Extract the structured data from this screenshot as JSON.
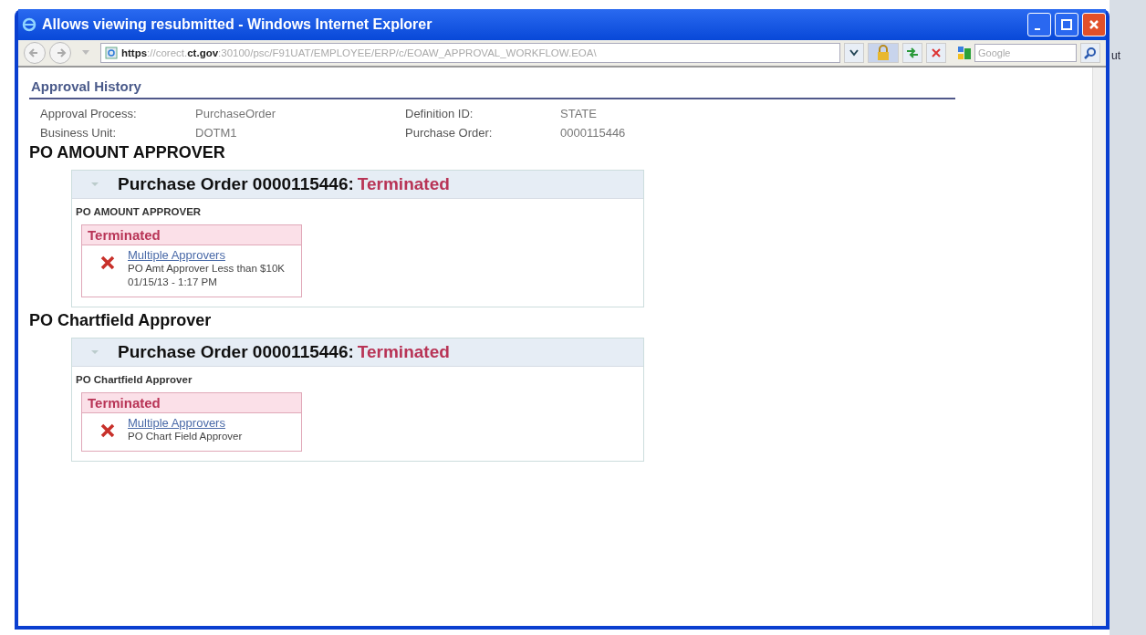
{
  "window": {
    "title": "Allows viewing resubmitted - Windows Internet Explorer"
  },
  "address_bar": {
    "url": "**https**://corect.**ct.gov**:30100/psc/F91UAT/EMPLOYEE/ERP/c/EOAW_APPROVAL_WORKFLOW.EOA\\"
  },
  "search": {
    "placeholder": "Google"
  },
  "background_text": "ut",
  "page": {
    "title": "Approval History",
    "fields": [
      {
        "label": "Approval Process:",
        "value": "PurchaseOrder"
      },
      {
        "label": "Definition ID:",
        "value": "STATE"
      },
      {
        "label": "Business Unit:",
        "value": "DOTM1"
      },
      {
        "label": "Purchase Order:",
        "value": "0000115446"
      }
    ],
    "sections": [
      {
        "heading": "PO AMOUNT APPROVER",
        "box_title": "Purchase Order 0000115446:",
        "box_status": "Terminated",
        "expanded": true,
        "stage": "PO AMOUNT APPROVER",
        "stage_status": "Terminated",
        "link": "Multiple Approvers",
        "lines": [
          "PO Amt Approver Less than $10K",
          "01/15/13 - 1:17 PM"
        ]
      },
      {
        "heading": "PO Chartfield Approver",
        "box_title": "Purchase Order 0000115446:",
        "box_status": "Terminated",
        "expanded": true,
        "stage": "PO Chartfield Approver",
        "stage_status": "Terminated",
        "link": "Multiple Approvers",
        "lines": [
          "PO Chart Field Approver"
        ]
      }
    ]
  }
}
